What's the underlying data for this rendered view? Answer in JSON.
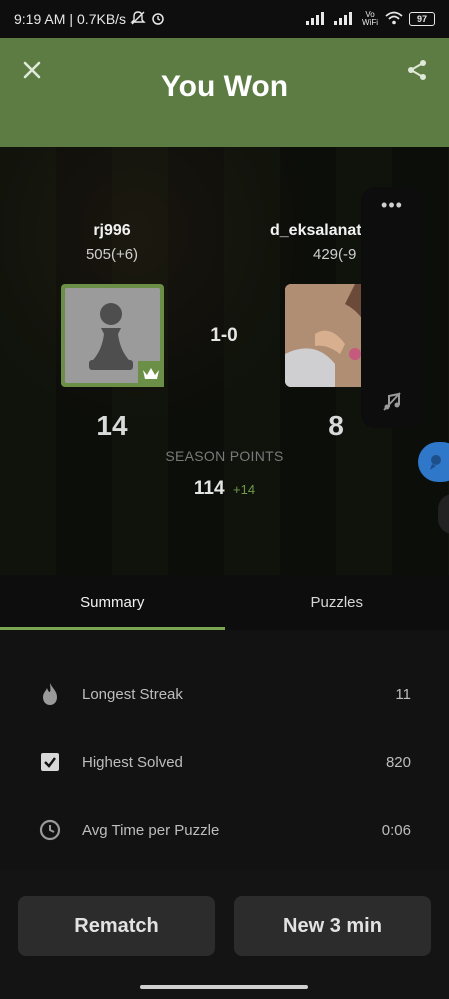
{
  "status_bar": {
    "time": "9:19 AM",
    "speed": "0.7KB/s",
    "network_label": "Vo WiFi",
    "battery": "97"
  },
  "header": {
    "title": "You Won",
    "color": "#5c7c44"
  },
  "players": {
    "left": {
      "name": "rj996",
      "rating": "505(+6)",
      "season_points": "14"
    },
    "right": {
      "name": "d_eksalanat",
      "rating": "429(-9",
      "season_points": "8"
    }
  },
  "result": {
    "score": "1-0"
  },
  "season": {
    "label": "SEASON POINTS",
    "total": "114",
    "delta": "+14"
  },
  "tabs": {
    "summary": "Summary",
    "puzzles": "Puzzles",
    "active": "Summary"
  },
  "summary_rows": [
    {
      "icon": "flame-icon",
      "label": "Longest Streak",
      "value": "11"
    },
    {
      "icon": "checkbox-icon",
      "label": "Highest Solved",
      "value": "820"
    },
    {
      "icon": "clock-icon",
      "label": "Avg Time per Puzzle",
      "value": "0:06"
    }
  ],
  "buttons": {
    "rematch": "Rematch",
    "new_game": "New 3 min"
  },
  "colors": {
    "accent_green": "#7aa551",
    "delta_green": "#6e9a48",
    "bubble_blue": "#2f77c9"
  }
}
